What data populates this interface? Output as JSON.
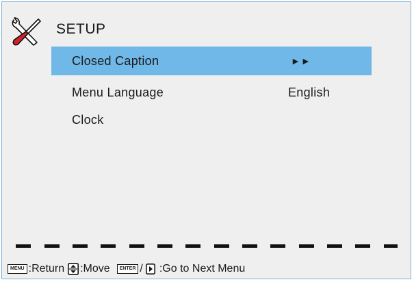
{
  "menu": {
    "title": "SETUP",
    "items": [
      {
        "label": "Closed Caption",
        "value": "►►",
        "selected": true
      },
      {
        "label": "Menu Language",
        "value": "English",
        "selected": false
      },
      {
        "label": "Clock",
        "value": "",
        "selected": false
      }
    ]
  },
  "footer": {
    "menu_key": "MENU",
    "return_text": ":Return",
    "move_text": ":Move",
    "enter_key": "ENTER",
    "slash": "/",
    "next_text": ":Go to Next Menu"
  },
  "colors": {
    "selection": "#6fb8e8",
    "panel_background": "#efefef",
    "panel_border": "#7fb0d6"
  },
  "icons": [
    "tools-icon",
    "up-down-icon",
    "right-arrow-icon"
  ]
}
